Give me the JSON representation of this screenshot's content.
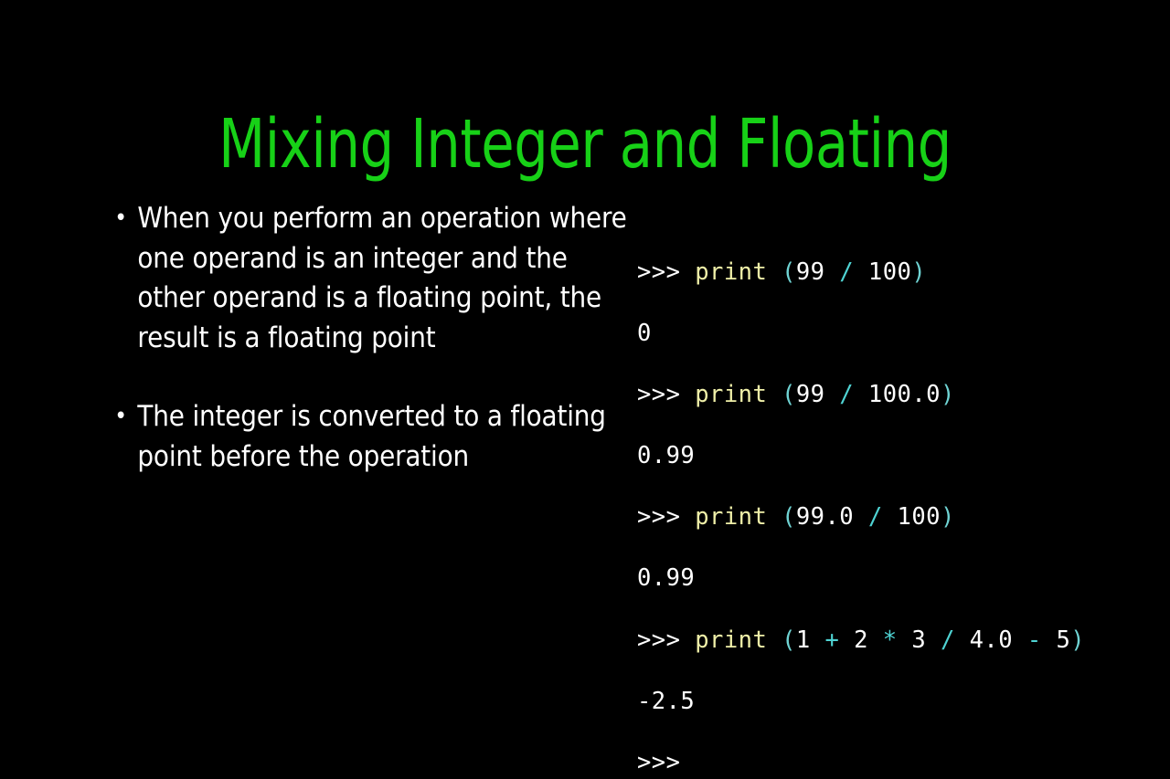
{
  "slide": {
    "title": "Mixing Integer and Floating",
    "title_color": "#17D117",
    "background_color": "#000000",
    "body_text_color": "#FFFFFF"
  },
  "bullets": [
    {
      "marker": "•",
      "text": "When you perform an operation where one operand is an integer and the other operand is a floating point, the result is a floating point"
    },
    {
      "marker": "•",
      "text": "The integer is converted to a floating point before the operation"
    }
  ],
  "console": {
    "prompt": ">>>",
    "keyword_color": "#EFEFA8",
    "punct_color": "#6FD3D3",
    "output_color": "#FFFFFF",
    "lines": [
      {
        "kind": "input",
        "text": ">>> print (99 / 100)",
        "tokens": [
          {
            "t": ">>>",
            "c": "prompt"
          },
          {
            "t": " ",
            "c": "plain"
          },
          {
            "t": "print",
            "c": "kw"
          },
          {
            "t": " ",
            "c": "plain"
          },
          {
            "t": "(",
            "c": "punct"
          },
          {
            "t": "99",
            "c": "num"
          },
          {
            "t": " ",
            "c": "plain"
          },
          {
            "t": "/",
            "c": "op"
          },
          {
            "t": " ",
            "c": "plain"
          },
          {
            "t": "100",
            "c": "num"
          },
          {
            "t": ")",
            "c": "punct"
          }
        ]
      },
      {
        "kind": "output",
        "text": "0",
        "tokens": [
          {
            "t": "0",
            "c": "out"
          }
        ]
      },
      {
        "kind": "input",
        "text": ">>> print (99 / 100.0)",
        "tokens": [
          {
            "t": ">>>",
            "c": "prompt"
          },
          {
            "t": " ",
            "c": "plain"
          },
          {
            "t": "print",
            "c": "kw"
          },
          {
            "t": " ",
            "c": "plain"
          },
          {
            "t": "(",
            "c": "punct"
          },
          {
            "t": "99",
            "c": "num"
          },
          {
            "t": " ",
            "c": "plain"
          },
          {
            "t": "/",
            "c": "op"
          },
          {
            "t": " ",
            "c": "plain"
          },
          {
            "t": "100.0",
            "c": "num"
          },
          {
            "t": ")",
            "c": "punct"
          }
        ]
      },
      {
        "kind": "output",
        "text": "0.99",
        "tokens": [
          {
            "t": "0.99",
            "c": "out"
          }
        ]
      },
      {
        "kind": "input",
        "text": ">>> print (99.0 / 100)",
        "tokens": [
          {
            "t": ">>>",
            "c": "prompt"
          },
          {
            "t": " ",
            "c": "plain"
          },
          {
            "t": "print",
            "c": "kw"
          },
          {
            "t": " ",
            "c": "plain"
          },
          {
            "t": "(",
            "c": "punct"
          },
          {
            "t": "99.0",
            "c": "num"
          },
          {
            "t": " ",
            "c": "plain"
          },
          {
            "t": "/",
            "c": "op"
          },
          {
            "t": " ",
            "c": "plain"
          },
          {
            "t": "100",
            "c": "num"
          },
          {
            "t": ")",
            "c": "punct"
          }
        ]
      },
      {
        "kind": "output",
        "text": "0.99",
        "tokens": [
          {
            "t": "0.99",
            "c": "out"
          }
        ]
      },
      {
        "kind": "input",
        "text": ">>> print (1 + 2 * 3 / 4.0 - 5)",
        "tokens": [
          {
            "t": ">>>",
            "c": "prompt"
          },
          {
            "t": " ",
            "c": "plain"
          },
          {
            "t": "print",
            "c": "kw"
          },
          {
            "t": " ",
            "c": "plain"
          },
          {
            "t": "(",
            "c": "punct"
          },
          {
            "t": "1",
            "c": "num"
          },
          {
            "t": " ",
            "c": "plain"
          },
          {
            "t": "+",
            "c": "op"
          },
          {
            "t": " ",
            "c": "plain"
          },
          {
            "t": "2",
            "c": "num"
          },
          {
            "t": " ",
            "c": "plain"
          },
          {
            "t": "*",
            "c": "op"
          },
          {
            "t": " ",
            "c": "plain"
          },
          {
            "t": "3",
            "c": "num"
          },
          {
            "t": " ",
            "c": "plain"
          },
          {
            "t": "/",
            "c": "op"
          },
          {
            "t": " ",
            "c": "plain"
          },
          {
            "t": "4.0",
            "c": "num"
          },
          {
            "t": " ",
            "c": "plain"
          },
          {
            "t": "-",
            "c": "op"
          },
          {
            "t": " ",
            "c": "plain"
          },
          {
            "t": "5",
            "c": "num"
          },
          {
            "t": ")",
            "c": "punct"
          }
        ]
      },
      {
        "kind": "output",
        "text": "-2.5",
        "tokens": [
          {
            "t": "-2.5",
            "c": "out"
          }
        ]
      },
      {
        "kind": "input",
        "text": ">>>",
        "tokens": [
          {
            "t": ">>>",
            "c": "prompt"
          }
        ]
      }
    ]
  }
}
